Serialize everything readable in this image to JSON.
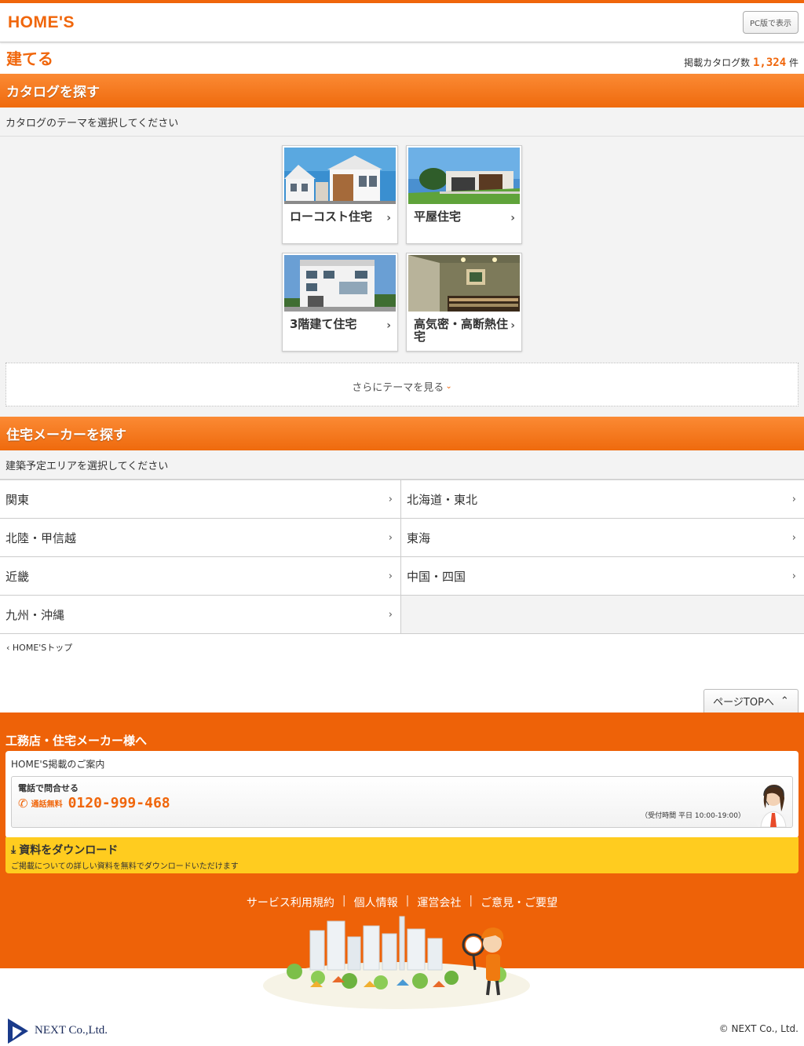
{
  "header": {
    "logo": "HOME'S",
    "pc_button": "PC版で表示"
  },
  "title_row": {
    "title": "建てる",
    "count_prefix": "掲載カタログ数",
    "count": "1,324",
    "count_suffix": "件"
  },
  "catalog_section": {
    "heading": "カタログを探す",
    "instruction": "カタログのテーマを選択してください",
    "themes": [
      {
        "label": "ローコスト住宅"
      },
      {
        "label": "平屋住宅"
      },
      {
        "label": "3階建て住宅"
      },
      {
        "label": "高気密・高断熱住宅"
      }
    ],
    "more_label": "さらにテーマを見る"
  },
  "maker_section": {
    "heading": "住宅メーカーを探す",
    "instruction": "建築予定エリアを選択してください",
    "areas": [
      "関東",
      "北海道・東北",
      "北陸・甲信越",
      "東海",
      "近畿",
      "中国・四国",
      "九州・沖縄"
    ]
  },
  "back_link": "HOME'Sトップ",
  "page_top": "ページTOPへ",
  "footer": {
    "heading": "工務店・住宅メーカー様へ",
    "biz_title": "HOME'S掲載のご案内",
    "tel_label": "電話で問合せる",
    "free_label": "通話無料",
    "tel_number": "0120-999-468",
    "hours": "（受付時間 平日 10:00-19:00）",
    "download_title": "資料をダウンロード",
    "download_desc": "ご掲載についての詳しい資料を無料でダウンロードいただけます",
    "links": [
      "サービス利用規約",
      "個人情報",
      "運営会社",
      "ご意見・ご要望"
    ]
  },
  "bottom": {
    "company": "NEXT Co.,Ltd.",
    "copyright": "© NEXT Co., Ltd."
  }
}
